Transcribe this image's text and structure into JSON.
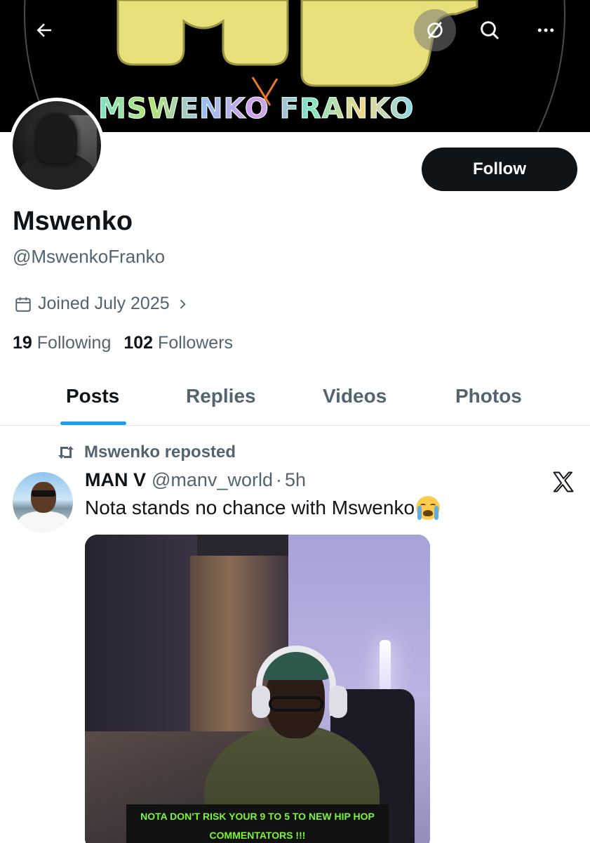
{
  "banner": {
    "text": "MSWENKO FRANKO",
    "colors": {
      "logo_yellow": "#e8e07a",
      "background": "#000000"
    }
  },
  "header": {
    "back_icon": "arrow-left-icon",
    "grok_icon": "grok-icon",
    "search_icon": "search-icon",
    "more_icon": "more-horizontal-icon"
  },
  "profile": {
    "follow_label": "Follow",
    "display_name": "Mswenko",
    "handle": "@MswenkoFranko",
    "joined": "Joined July 2025",
    "following_count": "19",
    "following_label": "Following",
    "followers_count": "102",
    "followers_label": "Followers"
  },
  "tabs": [
    {
      "label": "Posts",
      "active": true
    },
    {
      "label": "Replies",
      "active": false
    },
    {
      "label": "Videos",
      "active": false
    },
    {
      "label": "Photos",
      "active": false
    }
  ],
  "post": {
    "repost_label": "Mswenko reposted",
    "author_name": "MAN V",
    "author_handle": "@manv_world",
    "separator": "·",
    "time": "5h",
    "text": "Nota stands no chance with Mswenko",
    "emoji": "loudly-crying-face",
    "media_caption_line1": "NOTA DON'T RISK YOUR 9 TO 5 TO NEW HIP HOP",
    "media_caption_line2": "COMMENTATORS !!!"
  },
  "colors": {
    "accent": "#1d9bf0",
    "text_primary": "#0f1419",
    "text_secondary": "#536471",
    "caption_green": "#7bf43a"
  }
}
